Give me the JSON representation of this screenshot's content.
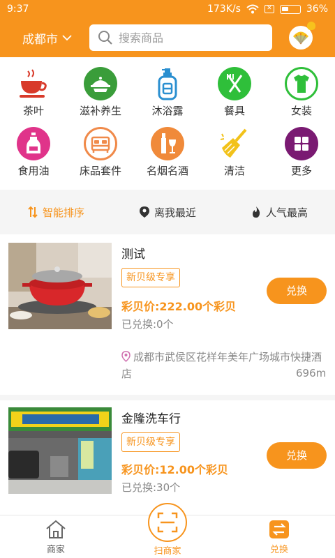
{
  "status": {
    "time": "9:37",
    "speed": "173K/s",
    "battery": "36%"
  },
  "header": {
    "city": "成都市",
    "search_placeholder": "搜索商品"
  },
  "categories": [
    {
      "label": "茶叶",
      "icon": "teacup-icon",
      "color": "#d83a2a"
    },
    {
      "label": "滋补养生",
      "icon": "pot-icon",
      "color": "#3a9d3a"
    },
    {
      "label": "沐浴露",
      "icon": "soap-bottle-icon",
      "color": "#2a8fd0"
    },
    {
      "label": "餐具",
      "icon": "utensils-icon",
      "color": "#2fbf3a"
    },
    {
      "label": "女装",
      "icon": "shirt-icon",
      "color": "#2fbf3a"
    },
    {
      "label": "食用油",
      "icon": "oil-bottle-icon",
      "color": "#e0348a"
    },
    {
      "label": "床品套件",
      "icon": "bed-icon",
      "color": "#f08a4a"
    },
    {
      "label": "名烟名酒",
      "icon": "wine-icon",
      "color": "#f08a3a"
    },
    {
      "label": "清洁",
      "icon": "broom-icon",
      "color": "#f2c21a"
    },
    {
      "label": "更多",
      "icon": "grid-icon",
      "color": "#7a1a72"
    }
  ],
  "sort": [
    {
      "label": "智能排序",
      "icon": "sort-icon"
    },
    {
      "label": "离我最近",
      "icon": "location-icon"
    },
    {
      "label": "人气最高",
      "icon": "flame-icon"
    }
  ],
  "items": [
    {
      "title": "测试",
      "tag": "新贝级专享",
      "price": "彩贝价:222.00个彩贝",
      "redeemed": "已兑换:0个",
      "button": "兑换",
      "address": "成都市武侯区花样年美年广场城市快捷酒店",
      "distance": "696m"
    },
    {
      "title": "金隆洗车行",
      "tag": "新贝级专享",
      "price": "彩贝价:12.00个彩贝",
      "redeemed": "已兑换:30个",
      "button": "兑换"
    }
  ],
  "tabs": [
    {
      "label": "商家"
    },
    {
      "label": "扫商家"
    },
    {
      "label": "兑换"
    }
  ],
  "colors": {
    "accent": "#f7941d"
  }
}
